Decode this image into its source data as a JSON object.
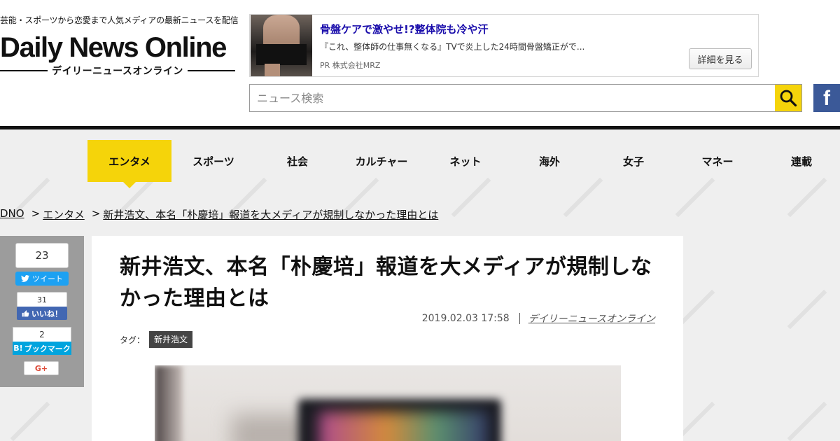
{
  "header": {
    "tagline": "芸能・スポーツから恋愛まで人気メディアの最新ニュースを配信",
    "logo": "Daily News Online",
    "logo_sub": "デイリーニュースオンライン"
  },
  "ad": {
    "title": "骨盤ケアで激やせ!?整体院も冷や汗",
    "description": "『これ、整体師の仕事無くなる』TVで炎上した24時間骨盤矯正がで...",
    "pr": "PR  株式会社MRZ",
    "button": "詳細を見る"
  },
  "search": {
    "placeholder": "ニュース検索",
    "value": ""
  },
  "social": {
    "facebook_glyph": "f"
  },
  "nav": {
    "items": [
      "エンタメ",
      "スポーツ",
      "社会",
      "カルチャー",
      "ネット",
      "海外",
      "女子",
      "マネー",
      "連載"
    ],
    "active": "エンタメ"
  },
  "breadcrumb": {
    "home": "DNO",
    "category": "エンタメ",
    "current": "新井浩文、本名「朴慶培」報道を大メディアが規制しなかった理由とは",
    "separator": ">"
  },
  "share": {
    "tweet_count": "23",
    "tweet_label": "ツイート",
    "like_count": "31",
    "like_label": "いいね！",
    "hatena_count": "2",
    "hatena_logo": "B!",
    "hatena_label": "ブックマーク",
    "gplus_label": "G+"
  },
  "article": {
    "title": "新井浩文、本名「朴慶培」報道を大メディアが規制しなかった理由とは",
    "date": "2019.02.03 17:58",
    "author": "デイリーニュースオンライン",
    "tag_label": "タグ：",
    "tags": [
      "新井浩文"
    ]
  },
  "colors": {
    "accent": "#f5d40a",
    "background": "#efefef",
    "facebook": "#3b5998",
    "twitter": "#1da1f2",
    "hatena": "#00a4de",
    "ad_link": "#1a0dab"
  }
}
